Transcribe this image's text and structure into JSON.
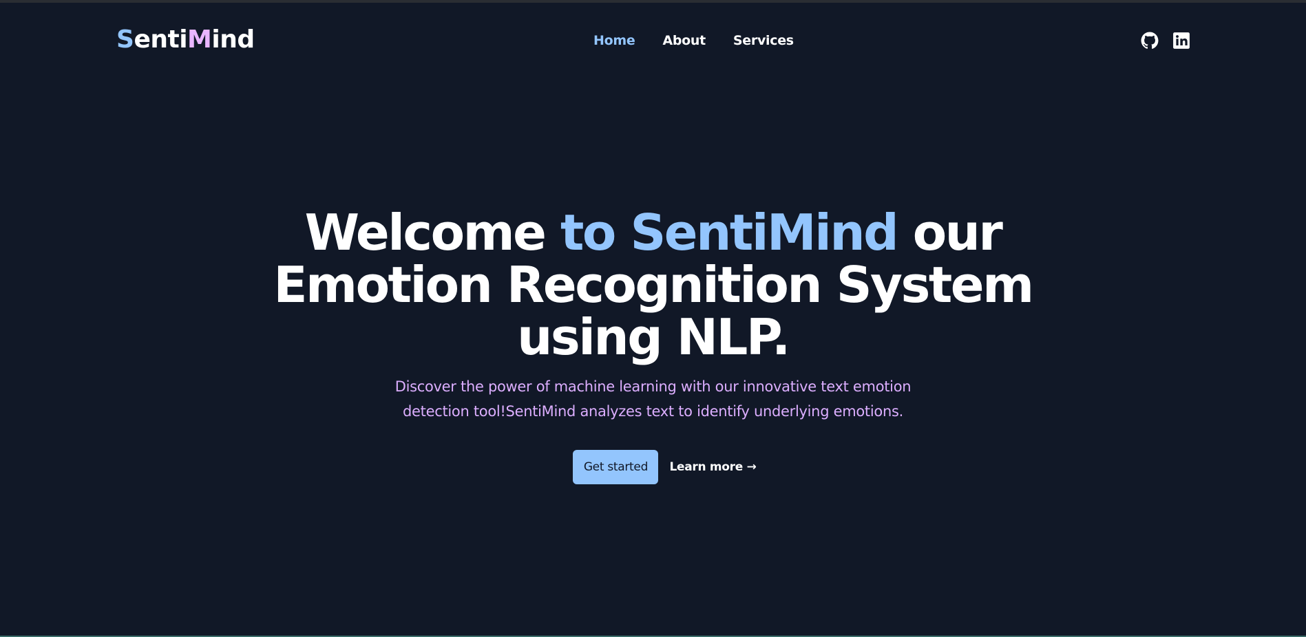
{
  "header": {
    "logo": {
      "parts": [
        "S",
        "enti",
        "M",
        "ind"
      ]
    },
    "nav": [
      {
        "label": "Home",
        "active": true
      },
      {
        "label": "About",
        "active": false
      },
      {
        "label": "Services",
        "active": false
      }
    ],
    "social": [
      {
        "icon": "github-icon"
      },
      {
        "icon": "linkedin-icon"
      }
    ]
  },
  "hero": {
    "headline_start": "Welcome ",
    "headline_accent": "to SentiMind",
    "headline_end": " our Emotion Recognition System using NLP.",
    "subtitle": "Discover the power of machine learning with our innovative text emotion detection tool!SentiMind analyzes text to identify underlying emotions.",
    "primary_button": "Get started",
    "secondary_link": "Learn more →"
  },
  "colors": {
    "background": "#111827",
    "accent": "#93c5fd",
    "subtitle": "#dcaeff"
  }
}
